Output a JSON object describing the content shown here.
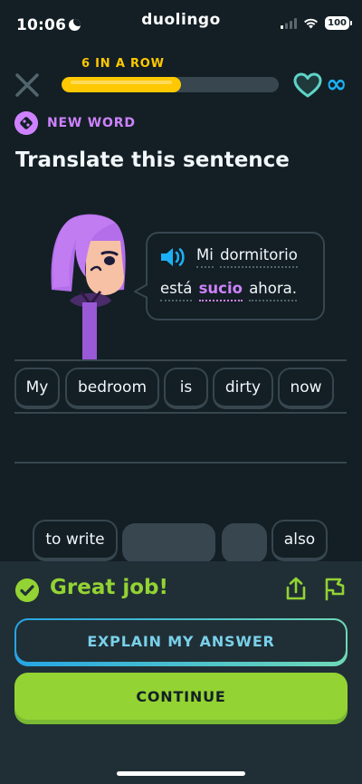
{
  "status_bar": {
    "time": "10:06",
    "app_name": "duolingo",
    "battery": "100"
  },
  "header": {
    "streak_label": "6 IN A ROW",
    "progress": 0.55,
    "hearts": "∞"
  },
  "lesson": {
    "badge_label": "NEW WORD",
    "title": "Translate this sentence",
    "prompt_words": [
      "Mi",
      "dormitorio",
      "está",
      "sucio",
      "ahora."
    ],
    "highlighted_word": "sucio"
  },
  "answer": {
    "selected_words": [
      "My",
      "bedroom",
      "is",
      "dirty",
      "now"
    ]
  },
  "word_bank": {
    "remaining": [
      "to write",
      "also"
    ]
  },
  "feedback": {
    "message": "Great job!",
    "explain_label": "EXPLAIN MY ANSWER",
    "continue_label": "CONTINUE"
  },
  "colors": {
    "background": "#131f24",
    "panel": "#202f36",
    "correct_green": "#93d333",
    "streak_yellow": "#ffc800",
    "new_word_purple": "#ce82ff",
    "infinity_blue": "#1cb0f6"
  },
  "icons": {
    "close": "close-icon",
    "heart": "heart-icon",
    "speaker": "speaker-icon",
    "check": "check-icon",
    "share": "share-icon",
    "flag": "flag-icon"
  }
}
